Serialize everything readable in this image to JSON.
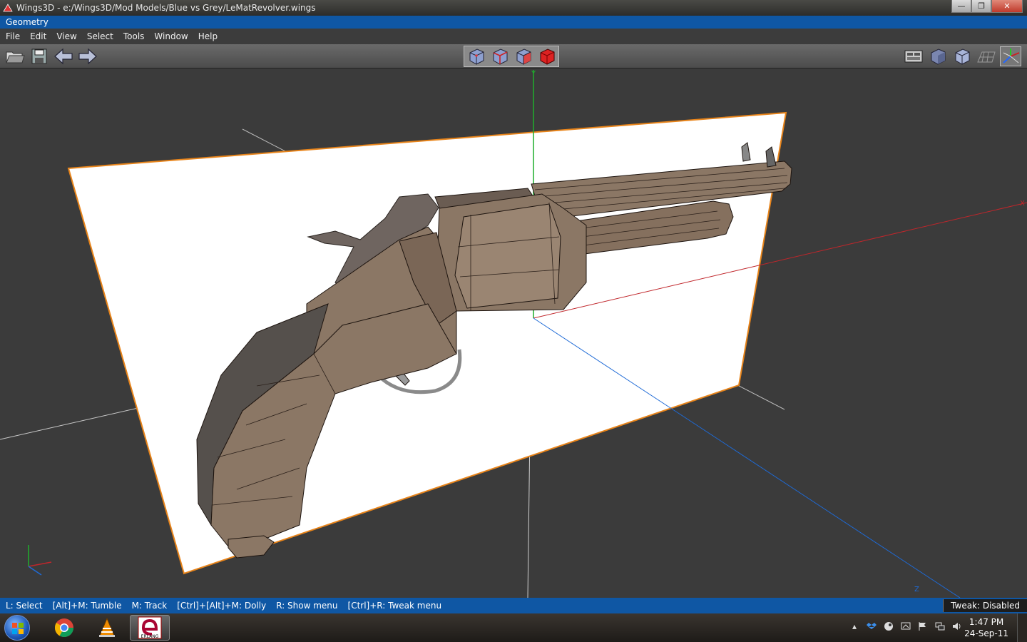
{
  "window": {
    "title": "Wings3D - e:/Wings3D/Mod Models/Blue vs Grey/LeMatRevolver.wings",
    "controls": {
      "minimize": "—",
      "maximize": "❐",
      "close": "✕"
    }
  },
  "geometry_header": "Geometry",
  "menu": [
    "File",
    "Edit",
    "View",
    "Select",
    "Tools",
    "Window",
    "Help"
  ],
  "toolbar": {
    "left_icons": [
      "open-folder-icon",
      "save-icon",
      "undo-arrow-icon",
      "redo-arrow-icon"
    ],
    "selection_modes": [
      "vertex-mode-icon",
      "edge-mode-icon",
      "face-mode-icon",
      "body-mode-icon"
    ],
    "right_icons": [
      "workmode-icon",
      "smooth-shading-icon",
      "flat-shading-icon",
      "groundplane-icon",
      "axes-icon"
    ]
  },
  "viewport": {
    "axis_labels": {
      "y": "Y",
      "x": "X",
      "z": "Z"
    },
    "colors": {
      "background": "#3b3b3b",
      "plane": "#ffffff",
      "plane_edge": "#e8841a",
      "model": "#8b7765",
      "x_axis": "#c0262b",
      "y_axis": "#1fae2c",
      "z_axis": "#1e6ad6"
    }
  },
  "statusbar": {
    "hints": [
      "L: Select",
      "[Alt]+M: Tumble",
      "M: Track",
      "[Ctrl]+[Alt]+M: Dolly",
      "R: Show menu",
      "[Ctrl]+R: Tweak menu"
    ],
    "tweak": "Tweak: Disabled"
  },
  "taskbar": {
    "apps": [
      "chrome-icon",
      "vlc-icon",
      "erlang-icon"
    ],
    "erlang_label": "ERLANG",
    "time": "1:47 PM",
    "date": "24-Sep-11"
  }
}
